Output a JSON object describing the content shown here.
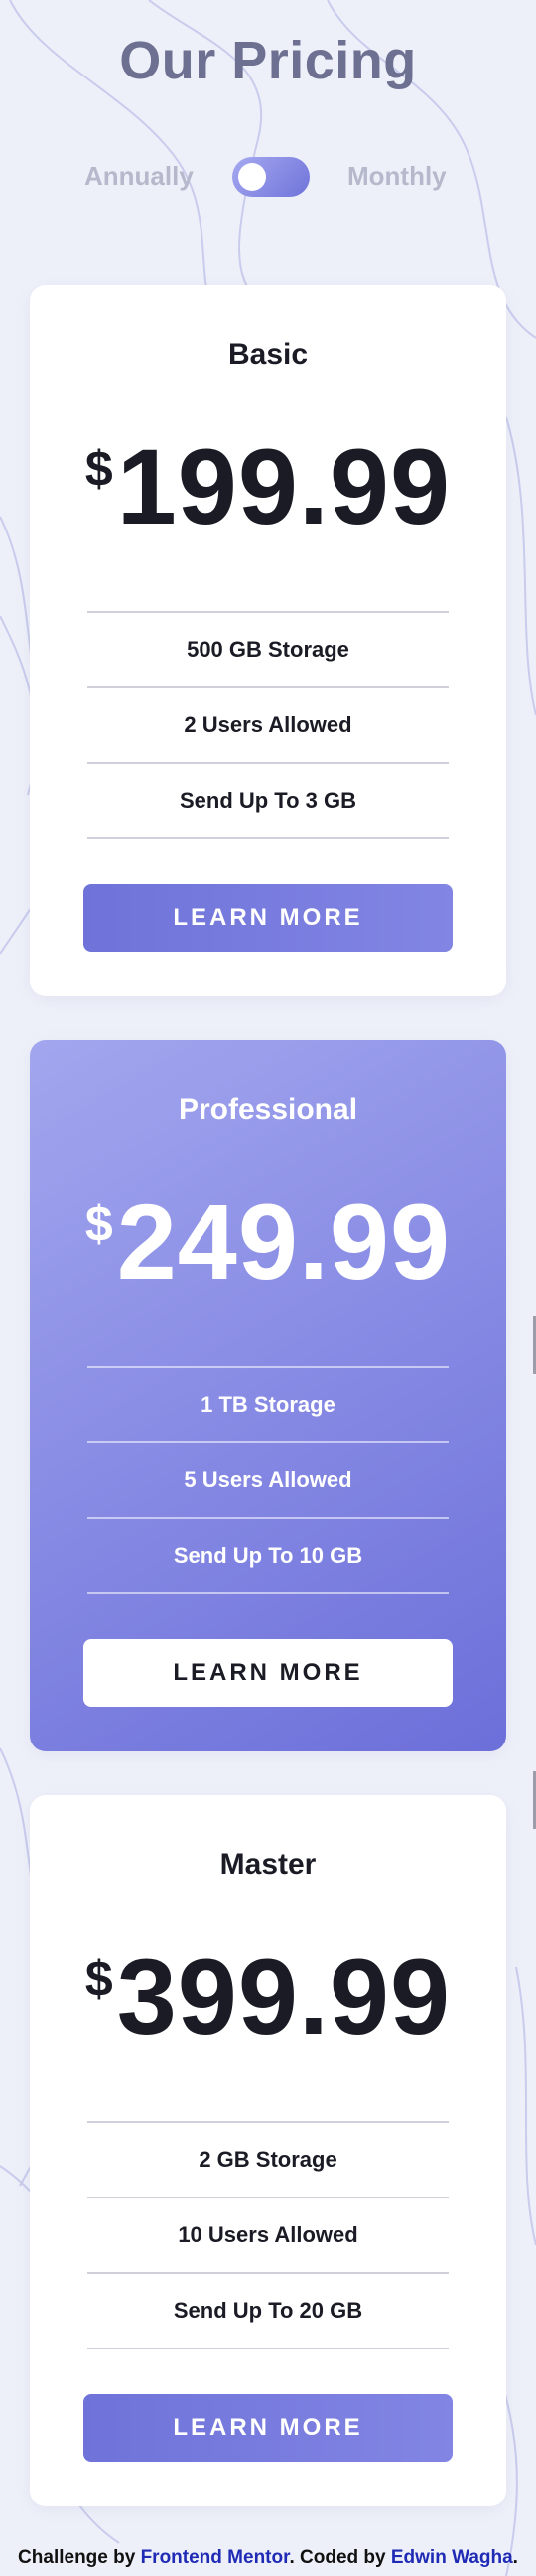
{
  "header": {
    "title": "Our Pricing",
    "toggle": {
      "left_label": "Annually",
      "right_label": "Monthly"
    }
  },
  "plans": [
    {
      "name": "Basic",
      "currency": "$",
      "price": "199.99",
      "features": [
        "500 GB Storage",
        "2 Users Allowed",
        "Send Up To 3 GB"
      ],
      "button_label": "LEARN MORE",
      "featured": false
    },
    {
      "name": "Professional",
      "currency": "$",
      "price": "249.99",
      "features": [
        "1 TB Storage",
        "5 Users Allowed",
        "Send Up To 10 GB"
      ],
      "button_label": "LEARN MORE",
      "featured": true
    },
    {
      "name": "Master",
      "currency": "$",
      "price": "399.99",
      "features": [
        "2 GB Storage",
        "10 Users Allowed",
        "Send Up To 20 GB"
      ],
      "button_label": "LEARN MORE",
      "featured": false
    }
  ],
  "footer": {
    "prefix": "Challenge by ",
    "link1": "Frontend Mentor",
    "middle": ". Coded by ",
    "link2": "Edwin Wagha",
    "suffix": "."
  },
  "colors": {
    "background": "#eef0f9",
    "accent_start": "#a2a6ee",
    "accent_end": "#6c6fd9",
    "title": "#6e7092",
    "toggle_label": "#b6b8cc",
    "link": "#1f2bb5"
  }
}
